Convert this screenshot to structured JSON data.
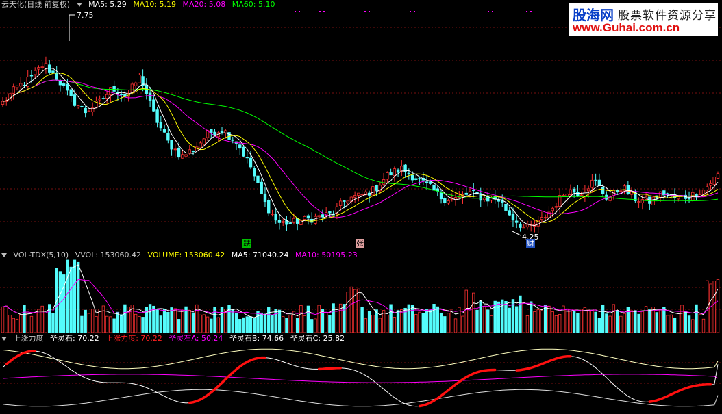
{
  "main_legend": {
    "name": "云天化(日线 前复权)",
    "items": [
      {
        "label": "MA5: 5.29",
        "color": "#ffffff"
      },
      {
        "label": "MA10: 5.19",
        "color": "#ffff00"
      },
      {
        "label": "MA20: 5.08",
        "color": "#ff00ff"
      },
      {
        "label": "MA60: 5.10",
        "color": "#00ff00"
      }
    ]
  },
  "vol_legend": {
    "name": "VOL-TDX(5,10)",
    "items": [
      {
        "label": "VVOL: 153060.42",
        "color": "#c8c8c8"
      },
      {
        "label": "VOLUME: 153060.42",
        "color": "#ffff00"
      },
      {
        "label": "MA5: 71040.24",
        "color": "#ffffff"
      },
      {
        "label": "MA10: 50195.23",
        "color": "#ff00ff"
      }
    ]
  },
  "ind_legend": {
    "items": [
      {
        "label": "上涨力度",
        "color": "#c8c8c8"
      },
      {
        "label": "圣灵石: 70.22",
        "color": "#ffffff"
      },
      {
        "label": "上涨力度: 70.22",
        "color": "#ff2020"
      },
      {
        "label": "圣灵石A: 50.24",
        "color": "#ff00ff"
      },
      {
        "label": "圣灵石B: 74.66",
        "color": "#ffffff"
      },
      {
        "label": "圣灵石C: 25.82",
        "color": "#ffffff"
      }
    ]
  },
  "annotations": {
    "high_label": "7.75",
    "low_label": "4.25",
    "tag_die": "跌",
    "tag_zhang": "张",
    "tag_cai": "财"
  },
  "watermark": {
    "logo": "股海网",
    "title": "股票软件资源分享",
    "url": "www.Guhai.com.cn"
  },
  "colors": {
    "up": "#ff3232",
    "down": "#54fcfc",
    "ma5": "#ffffff",
    "ma10": "#ffff00",
    "ma20": "#ff00ff",
    "ma60": "#00ff00",
    "grid": "#7a1010"
  },
  "chart_data": [
    {
      "type": "candlestick",
      "title": "云天化(日线 前复权)",
      "y_range": [
        4.0,
        8.0
      ],
      "high": 7.75,
      "low": 4.25,
      "ma_last": {
        "MA5": 5.29,
        "MA10": 5.19,
        "MA20": 5.08,
        "MA60": 5.1
      },
      "close_path": [
        6.45,
        6.7,
        6.85,
        7.1,
        6.85,
        6.5,
        6.3,
        6.45,
        6.7,
        6.55,
        6.9,
        6.25,
        5.8,
        5.55,
        5.7,
        5.95,
        6.0,
        5.8,
        5.4,
        4.8,
        4.45,
        4.45,
        4.5,
        4.55,
        4.6,
        4.85,
        4.9,
        5.0,
        5.25,
        5.35,
        5.2,
        5.05,
        4.85,
        4.85,
        4.95,
        4.85,
        4.85,
        4.55,
        4.35,
        4.45,
        4.7,
        5.0,
        4.95,
        5.15,
        4.85,
        5.05,
        4.85,
        4.8,
        4.95,
        4.85,
        4.9,
        5.0,
        5.25
      ]
    },
    {
      "type": "bar",
      "title": "VOL-TDX(5,10)",
      "last": {
        "VVOL": 153060.42,
        "VOLUME": 153060.42,
        "MA5": 71040.24,
        "MA10": 50195.23
      }
    },
    {
      "type": "line",
      "title": "上涨力度",
      "last": {
        "圣灵石": 70.22,
        "上涨力度": 70.22,
        "圣灵石A": 50.24,
        "圣灵石B": 74.66,
        "圣灵石C": 25.82
      }
    }
  ]
}
